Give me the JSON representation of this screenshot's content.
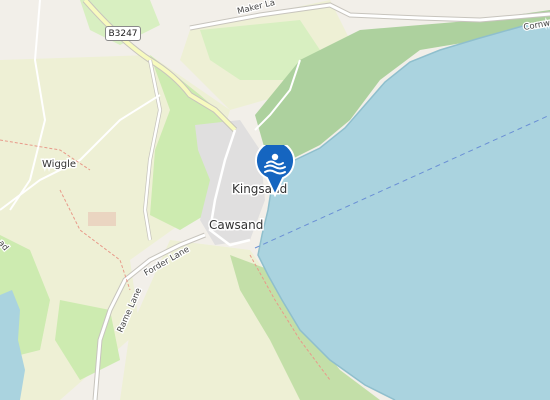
{
  "map": {
    "places": {
      "kingsand": "Kingsand",
      "cawsand": "Cawsand",
      "wiggle": "Wiggle"
    },
    "roads": {
      "maker_lane": "Maker La",
      "forder_lane": "Forder Lane",
      "rame_lane": "Rame Lane",
      "road_ref": "B3247",
      "edge_label_top": "Cornw",
      "edge_label_left": "ad"
    },
    "marker": {
      "icon": "swimming-icon",
      "color": "#1565c0"
    },
    "colors": {
      "water": "#aad3df",
      "land": "#f2efe9",
      "grass": "#cdebb0",
      "wood": "#add19e",
      "farmland": "#eef0d5",
      "road": "#ffffff",
      "primary_road": "#f7fabf",
      "ferry": "#6a8fd5"
    }
  }
}
